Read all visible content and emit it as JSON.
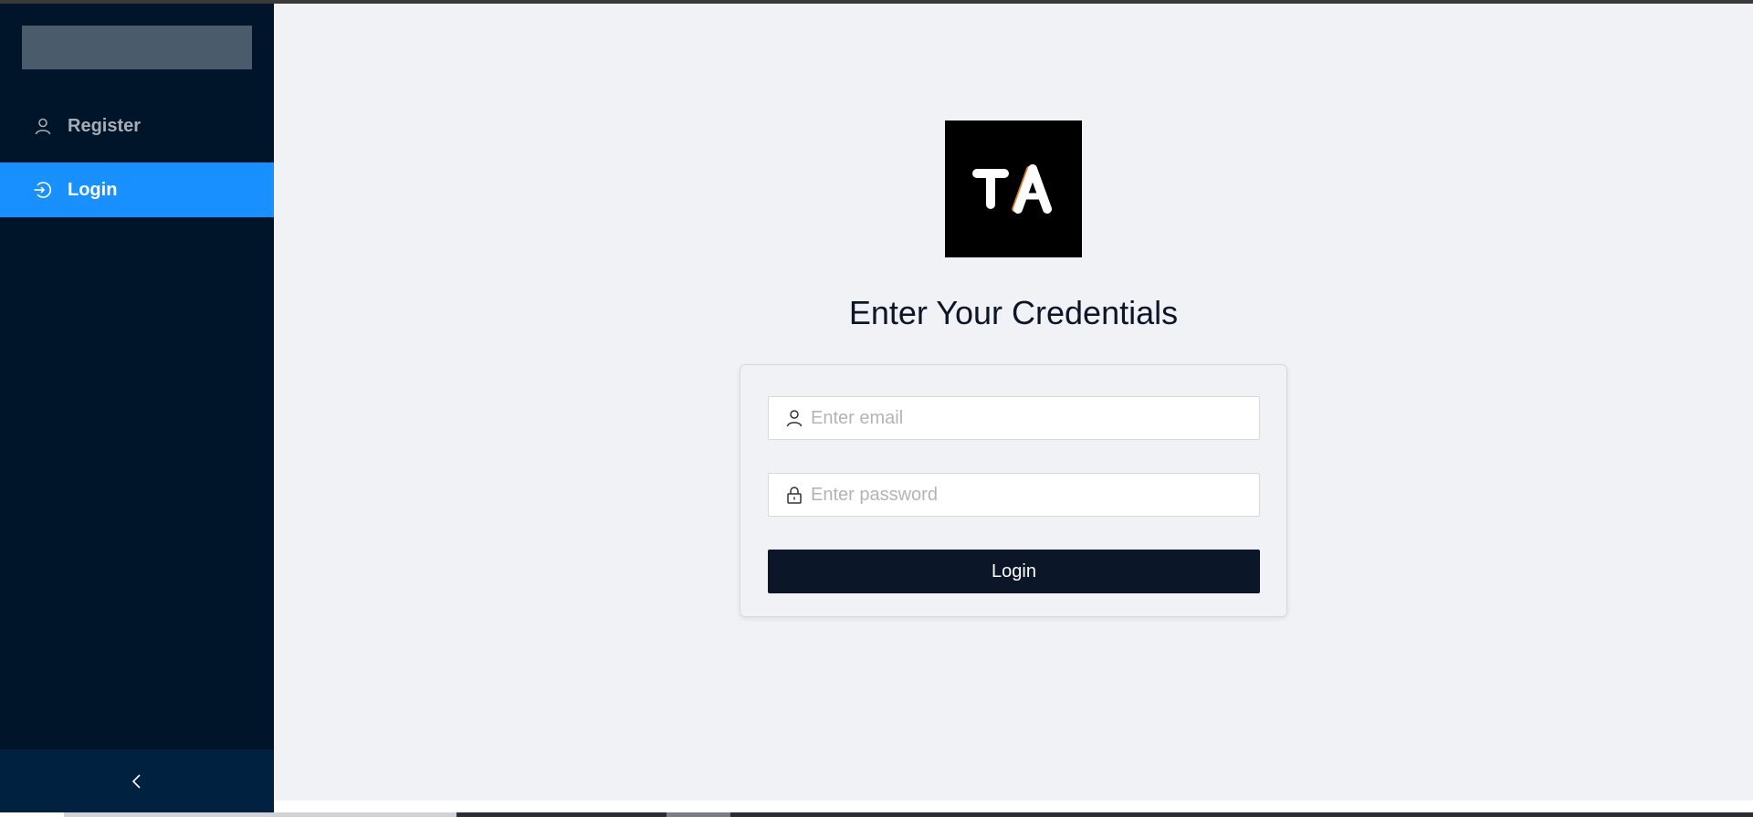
{
  "sidebar": {
    "items": [
      {
        "label": "Register",
        "icon": "user-icon"
      },
      {
        "label": "Login",
        "icon": "login-icon",
        "active": true
      }
    ],
    "collapse_icon": "chevron-left-icon"
  },
  "main": {
    "logo_text": "TA",
    "title": "Enter Your Credentials",
    "email_placeholder": "Enter email",
    "password_placeholder": "Enter password",
    "login_button": "Login"
  },
  "colors": {
    "sidebar_bg": "#001529",
    "active_item": "#1890ff",
    "button_bg": "#0b1628",
    "page_bg": "#f0f2f5",
    "logo_accent": "#e07b2a"
  }
}
